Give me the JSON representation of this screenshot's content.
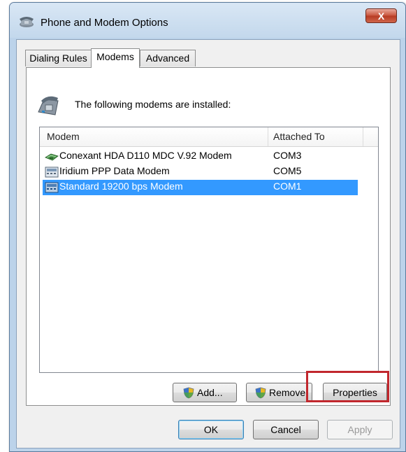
{
  "window": {
    "title": "Phone and Modem Options",
    "close_label": "X"
  },
  "tabs": [
    {
      "label": "Dialing Rules",
      "active": false
    },
    {
      "label": "Modems",
      "active": true
    },
    {
      "label": "Advanced",
      "active": false
    }
  ],
  "panel": {
    "intro": "The following modems are installed:"
  },
  "modem_list": {
    "columns": [
      "Modem",
      "Attached To"
    ],
    "rows": [
      {
        "name": "Conexant HDA D110 MDC V.92 Modem",
        "port": "COM3",
        "icon": "modem-icon",
        "selected": false
      },
      {
        "name": "Iridium PPP Data Modem",
        "port": "COM5",
        "icon": "modem-device-icon",
        "selected": false
      },
      {
        "name": "Standard 19200 bps Modem",
        "port": "COM1",
        "icon": "modem-device-icon",
        "selected": true
      }
    ]
  },
  "panel_buttons": {
    "add": "Add...",
    "remove": "Remove",
    "properties": "Properties"
  },
  "dialog_buttons": {
    "ok": "OK",
    "cancel": "Cancel",
    "apply": "Apply"
  },
  "colors": {
    "selection": "#3399ff",
    "highlight": "#c1272d"
  }
}
